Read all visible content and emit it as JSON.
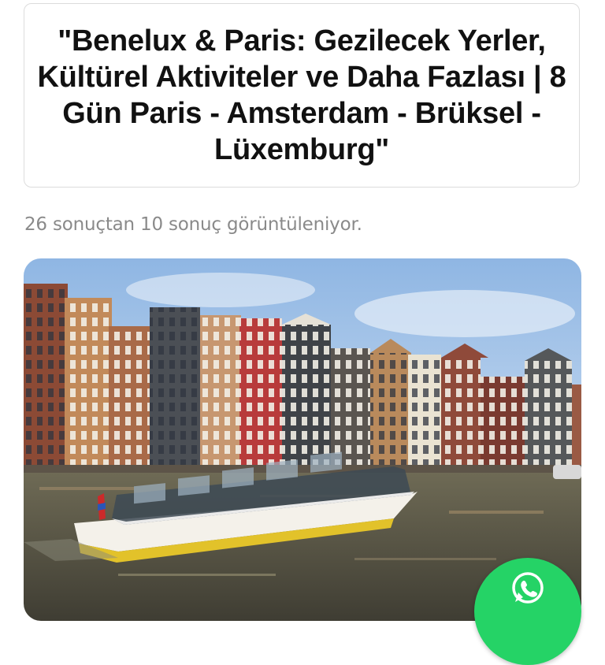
{
  "product": {
    "title": "\"Benelux & Paris: Gezilecek Yerler, Kültürel Aktiviteler ve Daha Fazlası | 8 Gün Paris - Amsterdam - Brüksel - Lüxemburg\""
  },
  "results": {
    "summary": "26 sonuçtan 10 sonuç görüntüleniyor."
  },
  "image": {
    "subject": "Amsterdam canal with tour boat and canal houses"
  },
  "floating_action": {
    "icon": "whatsapp-icon",
    "color": "#25d366"
  }
}
